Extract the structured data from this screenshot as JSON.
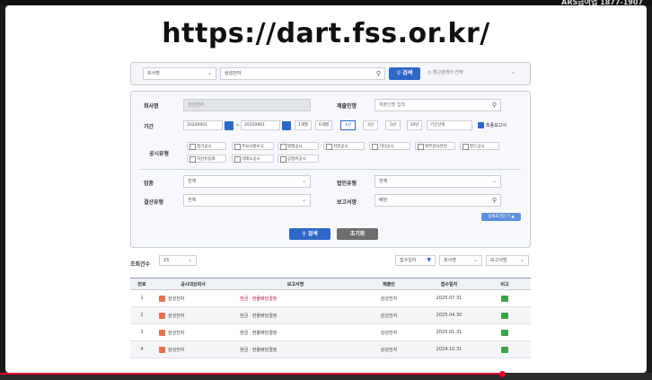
{
  "brand": "ARS금여업 1877-1907",
  "url_title": "https://dart.fss.or.kr/",
  "search": {
    "type_select": "회사명",
    "query": "삼성전자",
    "search_button": "검색",
    "recent_select": "최근검색어 선택"
  },
  "form": {
    "company_label": "회사명",
    "company_value": "삼성전자",
    "submitter_label": "제출인명",
    "submitter_placeholder": "제출인명 입력",
    "period_label": "기간",
    "date_from": "20240901",
    "date_to": "20250901",
    "tilde": "~",
    "period_buttons": [
      "1개월",
      "6개월",
      "1년",
      "3년",
      "5년",
      "10년"
    ],
    "period_selected": "1년",
    "period_select": "기간선택",
    "final_report_label": "최종보고서",
    "disclosure_type_label": "공시유형",
    "disclosure_types_row1": [
      "정기공시",
      "주요사항보고",
      "발행공시",
      "지분공시",
      "기타공시",
      "외부감사관련",
      "펀드공시"
    ],
    "disclosure_types_row2": [
      "자산유동화",
      "거래소공시",
      "공정위공시"
    ],
    "industry_label": "업종",
    "industry_value": "전체",
    "corp_type_label": "법인유형",
    "corp_type_value": "전체",
    "settlement_label": "결산유형",
    "settlement_value": "전체",
    "report_name_label": "보고서명",
    "report_name_value": "배당",
    "detail_toggle": "상세조건닫기 ▲",
    "search_button": "검색",
    "reset_button": "초기화"
  },
  "results": {
    "count_label": "조회건수",
    "count_value": "15",
    "sort_options": [
      "접수일자",
      "회사명",
      "보고서명"
    ],
    "columns": [
      "번호",
      "공시대상회사",
      "보고서명",
      "제출인",
      "접수일자",
      "비고"
    ],
    "rows": [
      {
        "no": "1",
        "company": "삼성전자",
        "report": "현금ㆍ현물배당결정",
        "submitter": "삼성전자",
        "date": "2025.07.31"
      },
      {
        "no": "2",
        "company": "삼성전자",
        "report": "현금ㆍ현물배당결정",
        "submitter": "삼성전자",
        "date": "2025.04.30"
      },
      {
        "no": "3",
        "company": "삼성전자",
        "report": "현금ㆍ현물배당결정",
        "submitter": "삼성전자",
        "date": "2025.01.31"
      },
      {
        "no": "4",
        "company": "삼성전자",
        "report": "현금ㆍ현물배당결정",
        "submitter": "삼성전자",
        "date": "2024.10.31"
      }
    ]
  },
  "icons": {
    "search": "search-icon",
    "calendar": "calendar-icon",
    "chevron": "chevron-down-icon",
    "company_badge": "company-badge-icon",
    "note": "note-icon"
  },
  "colors": {
    "primary": "#2f67c7",
    "report_link": "#b0173f",
    "badge": "#e4744f",
    "note": "#3aa24b",
    "progress": "#e3002b"
  }
}
